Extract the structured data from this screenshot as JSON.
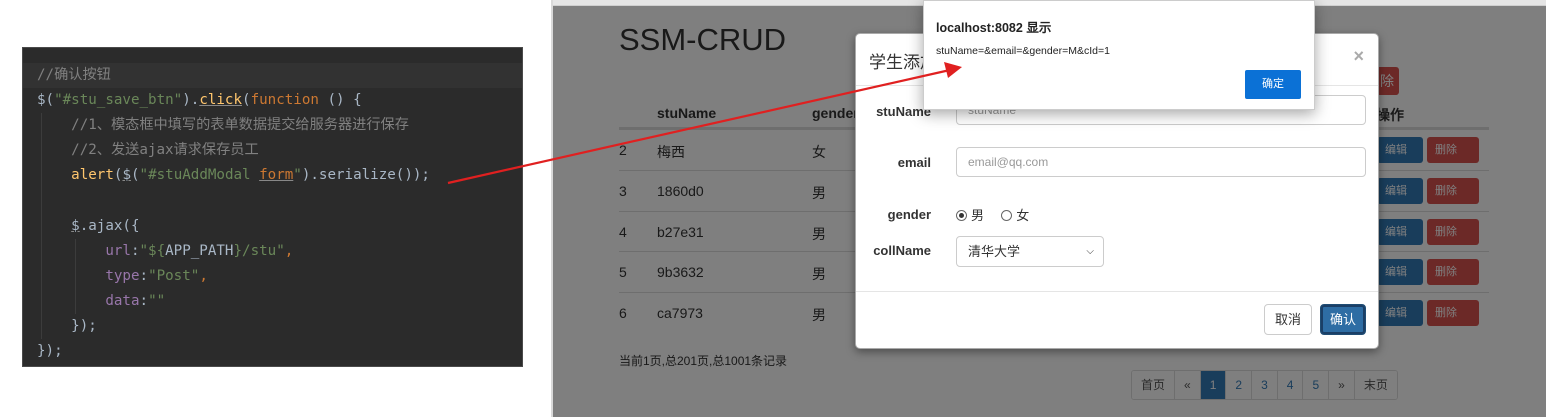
{
  "code": {
    "lines": [
      [
        "//确认按钮"
      ],
      [
        "$(",
        "\"#stu_save_btn\"",
        ").",
        "click",
        "(",
        "function",
        " () {"
      ],
      [
        "//1、模态框中填写的表单数据提交给服务器进行保存"
      ],
      [
        "//2、发送ajax请求保存员工"
      ],
      [
        "alert",
        "(",
        "$",
        "(",
        "\"#stuAddModal ",
        "form",
        "\"",
        ").serialize());"
      ],
      [],
      [
        "$",
        ".ajax({"
      ],
      [
        "url",
        ":",
        "\"${",
        "APP_PATH",
        "}/stu\"",
        ","
      ],
      [
        "type",
        ":",
        "\"Post\"",
        ","
      ],
      [
        "data",
        ":",
        "\"\""
      ],
      [
        "});"
      ],
      [
        "});"
      ]
    ]
  },
  "page": {
    "title": "SSM-CRUD",
    "columns": {
      "id": "",
      "name": "stuName",
      "gender": "gender",
      "ops": "操作"
    },
    "rows": [
      {
        "id": "2",
        "name": "梅西",
        "gender": "女"
      },
      {
        "id": "3",
        "name": "1860d0",
        "gender": "男"
      },
      {
        "id": "4",
        "name": "b27e31",
        "gender": "男"
      },
      {
        "id": "5",
        "name": "9b3632",
        "gender": "男"
      },
      {
        "id": "6",
        "name": "ca7973",
        "gender": "男"
      }
    ],
    "edit_label": "编辑",
    "delete_label": "删除",
    "top_delete_label": "除",
    "record_info": "当前1页,总201页,总1001条记录",
    "pagination": [
      "首页",
      "«",
      "1",
      "2",
      "3",
      "4",
      "5",
      "»",
      "末页"
    ],
    "active_page": "1"
  },
  "modal": {
    "title": "学生添加",
    "close": "×",
    "fields": {
      "name_label": "stuName",
      "name_placeholder": "stuName",
      "email_label": "email",
      "email_placeholder": "email@qq.com",
      "gender_label": "gender",
      "gender_male": "男",
      "gender_female": "女",
      "coll_label": "collName",
      "coll_value": "清华大学"
    },
    "cancel_label": "取消",
    "confirm_label": "确认"
  },
  "alert": {
    "title": "localhost:8082 显示",
    "message": "stuName=&email=&gender=M&cId=1",
    "ok_label": "确定"
  },
  "colors": {
    "editor_bg": "#2b2b2b",
    "primary": "#337ab7",
    "danger": "#d9534f",
    "alert_button": "#0b71d6",
    "arrow": "#e02020"
  }
}
